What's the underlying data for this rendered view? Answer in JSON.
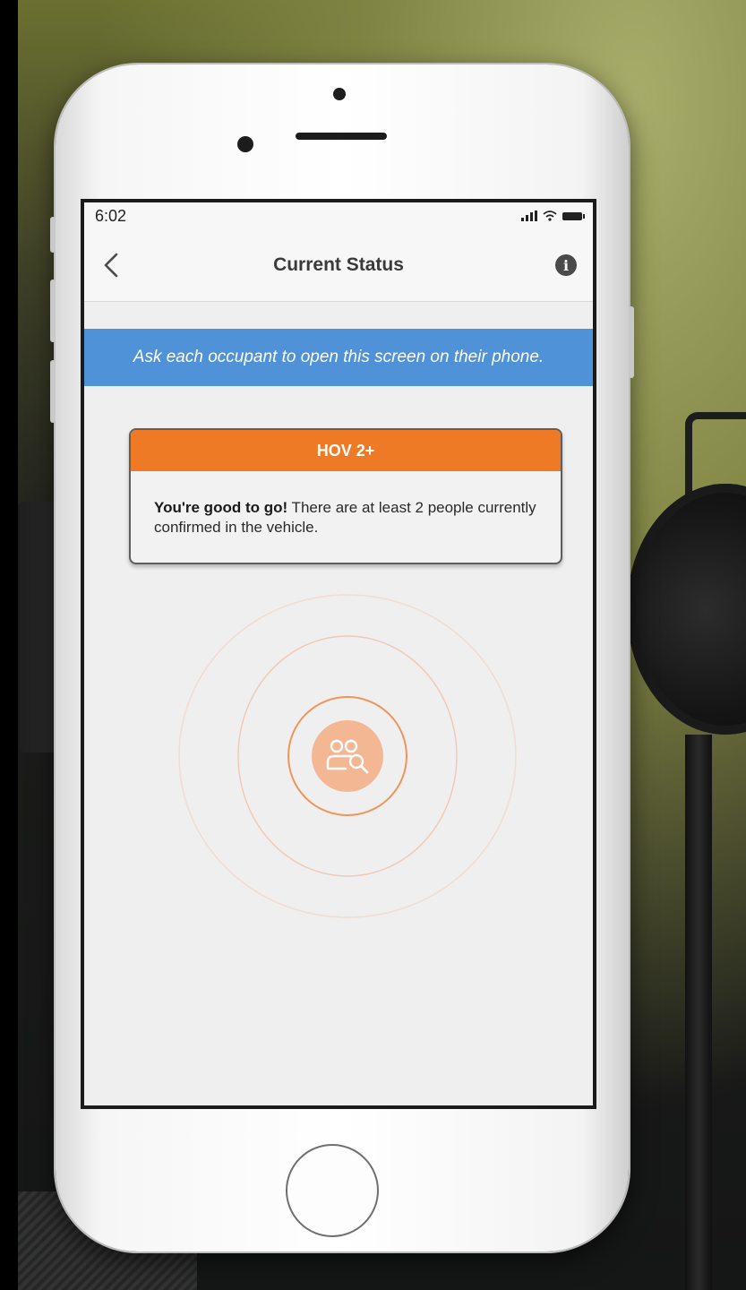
{
  "status_bar": {
    "time": "6:02"
  },
  "nav": {
    "title": "Current Status",
    "back_icon": "chevron-left-icon",
    "info_icon": "info-icon",
    "info_glyph": "i"
  },
  "banner": {
    "text": "Ask each occupant to open this screen on their phone."
  },
  "status_card": {
    "header": "HOV 2+",
    "body_bold": "You're good to go!",
    "body_text": " There are at least 2 people currently confirmed in the vehicle."
  },
  "scan": {
    "icon": "occupant-search-icon"
  },
  "colors": {
    "banner_blue": "#4f92d8",
    "hov_orange": "#ef7a25",
    "scan_peach": "#f3b794",
    "ring_orange": "#f0a070"
  }
}
